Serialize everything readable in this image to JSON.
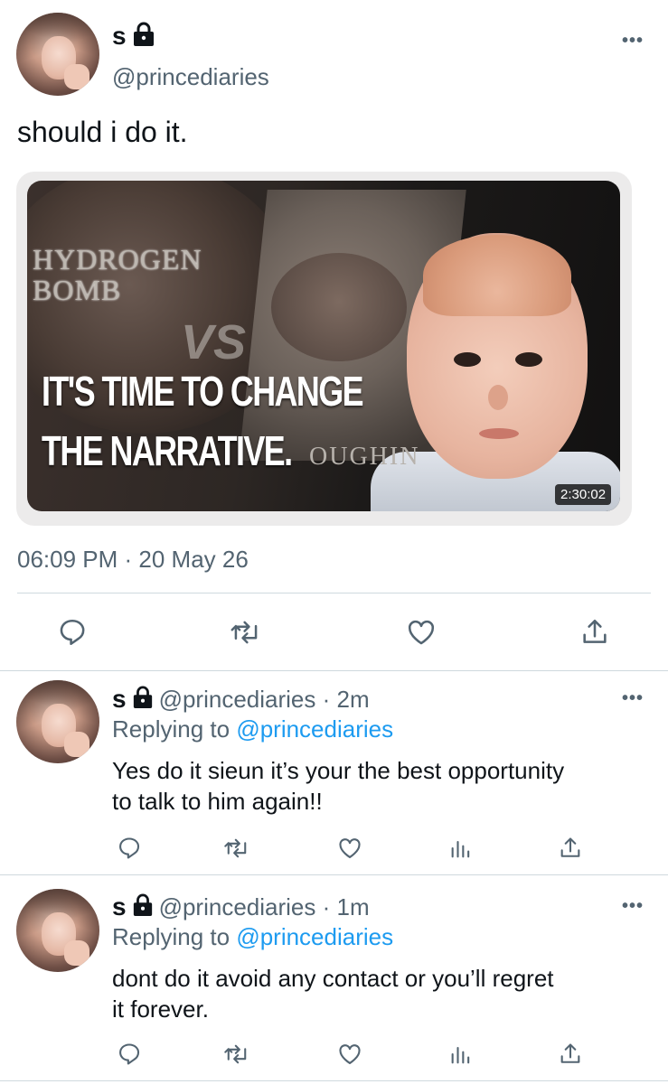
{
  "main_tweet": {
    "display_name": "s",
    "handle": "@princediaries",
    "text": "should i do it.",
    "media": {
      "label_left": "HYDROGEN\nBOMB",
      "vs_text": "VS",
      "overlay_line1": "IT'S TIME TO CHANGE",
      "overlay_line2": "THE NARRATIVE.",
      "behind_text": "OUGHIN",
      "duration": "2:30:02"
    },
    "timestamp": "06:09 PM · 20 May 26",
    "actions": {
      "reply_icon": "reply-icon",
      "retweet_icon": "retweet-icon",
      "like_icon": "like-icon",
      "share_icon": "share-icon"
    }
  },
  "replies": [
    {
      "display_name": "s",
      "handle_time": "@princediaries · 2m",
      "replying_prefix": "Replying to ",
      "replying_handle": "@princediaries",
      "text_line1": "Yes do it sieun it’s your the best opportunity",
      "text_line2": "to talk to him again!!"
    },
    {
      "display_name": "s",
      "handle_time": "@princediaries · 1m",
      "replying_prefix": "Replying to ",
      "replying_handle": "@princediaries",
      "text_line1": "dont do it avoid any contact or you’ll regret",
      "text_line2": "it forever."
    }
  ],
  "colors": {
    "text_primary": "#0f1419",
    "text_secondary": "#536471",
    "link": "#1d9bf0",
    "divider": "#cfd9de"
  }
}
